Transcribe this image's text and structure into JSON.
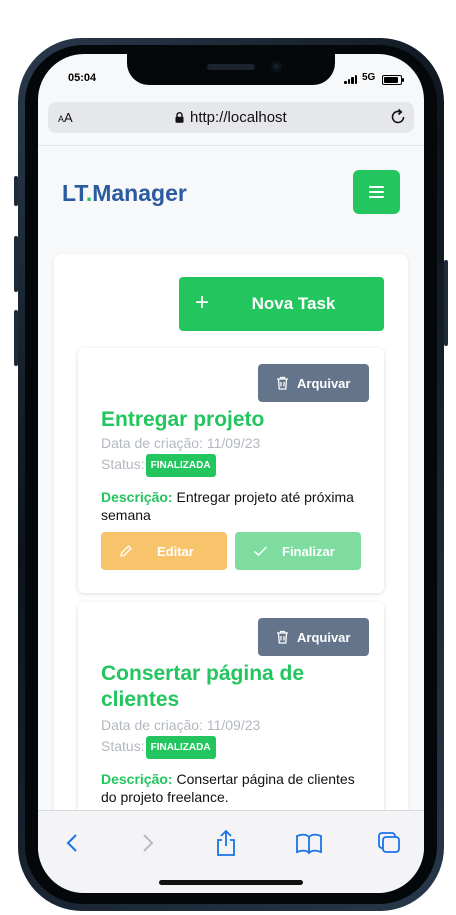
{
  "status_bar": {
    "time": "05:04",
    "network": "5G"
  },
  "browser": {
    "aa_label": "AA",
    "url": "http://localhost"
  },
  "header": {
    "brand_main": "LT",
    "brand_dot": ".",
    "brand_rest": "Manager"
  },
  "actions": {
    "new_task_label": "Nova Task"
  },
  "tasks": [
    {
      "archive_label": "Arquivar",
      "title": "Entregar projeto",
      "created_label": "Data de criação:",
      "created_date": "11/09/23",
      "status_label": "Status:",
      "status_value": "FINALIZADA",
      "description_label": "Descrição:",
      "description": "Entregar projeto até próxima semana",
      "edit_label": "Editar",
      "finish_label": "Finalizar"
    },
    {
      "archive_label": "Arquivar",
      "title": "Consertar página de clientes",
      "created_label": "Data de criação:",
      "created_date": "11/09/23",
      "status_label": "Status:",
      "status_value": "FINALIZADA",
      "description_label": "Descrição:",
      "description": "Consertar página de clientes do projeto freelance."
    }
  ],
  "colors": {
    "primary": "#22c55e",
    "brand": "#2a5aa0",
    "archive": "#64748b",
    "edit": "#f8c46b",
    "finish_disabled": "#7ddc9e"
  },
  "icons": [
    "plus-icon",
    "trash-icon",
    "pencil-icon",
    "check-icon",
    "menu-icon",
    "lock-icon",
    "reload-icon",
    "back-icon",
    "forward-icon",
    "share-icon",
    "bookmarks-icon",
    "tabs-icon"
  ]
}
